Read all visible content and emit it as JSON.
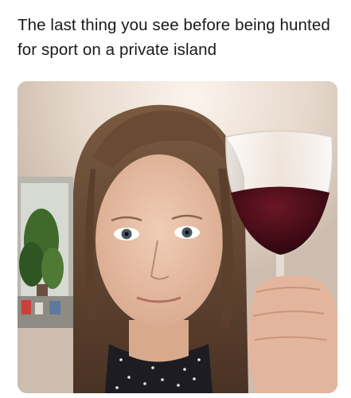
{
  "caption": {
    "text": "The last thing you see before being hunted for sport on a private island"
  },
  "photo": {
    "alt_subject": "selfie-with-wine-glass"
  },
  "colors": {
    "background": "#ffffff",
    "caption_text": "#1a1a1a",
    "wall": "#d8cbbf",
    "hair": "#5a4030",
    "skin": "#e8bfa7",
    "wine": "#4a0d1a",
    "shirt": "#1c1c22"
  }
}
